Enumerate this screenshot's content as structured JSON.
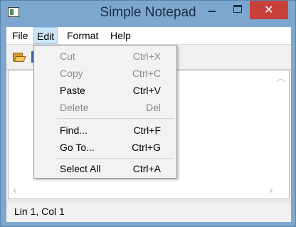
{
  "window": {
    "title": "Simple Notepad",
    "close_glyph": "✕"
  },
  "menubar": {
    "items": [
      "File",
      "Edit",
      "Format",
      "Help"
    ],
    "open_menu": "Edit"
  },
  "toolbar": {
    "icons": [
      "open-folder-icon",
      "save-icon"
    ]
  },
  "edit_menu": {
    "items": [
      {
        "label": "Cut",
        "shortcut": "Ctrl+X",
        "enabled": false
      },
      {
        "label": "Copy",
        "shortcut": "Ctrl+C",
        "enabled": false
      },
      {
        "label": "Paste",
        "shortcut": "Ctrl+V",
        "enabled": true
      },
      {
        "label": "Delete",
        "shortcut": "Del",
        "enabled": false
      },
      {
        "label": "Find...",
        "shortcut": "Ctrl+F",
        "enabled": true
      },
      {
        "label": "Go To...",
        "shortcut": "Ctrl+G",
        "enabled": true
      },
      {
        "label": "Select All",
        "shortcut": "Ctrl+A",
        "enabled": true
      }
    ]
  },
  "editor": {
    "content": ""
  },
  "scrollbars": {
    "up_arrow": "︿",
    "left_arrow": "‹",
    "right_arrow": "›"
  },
  "statusbar": {
    "position": "Lin 1, Col 1"
  },
  "colors": {
    "title_bar": "#7ea7cf",
    "close_button": "#c7403a",
    "menu_highlight": "#cce4f7"
  }
}
